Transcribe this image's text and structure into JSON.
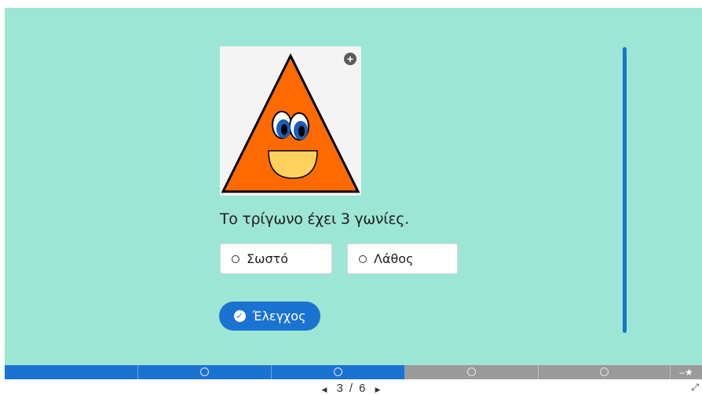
{
  "question": {
    "text": "Το τρίγωνο έχει 3 γωνίες."
  },
  "options": [
    {
      "label": "Σωστό"
    },
    {
      "label": "Λάθος"
    }
  ],
  "check_button": {
    "label": "Έλεγχος",
    "icon": "check-circle-icon"
  },
  "image": {
    "zoom_icon": "plus-circle-icon"
  },
  "pager": {
    "current": "3",
    "separator": "/",
    "total": "6"
  },
  "colors": {
    "stage": "#9de5d4",
    "accent": "#1a73d0",
    "progress_inactive": "#9a9a9a",
    "triangle": "#ff6a00",
    "mouth": "#ffd25e"
  }
}
